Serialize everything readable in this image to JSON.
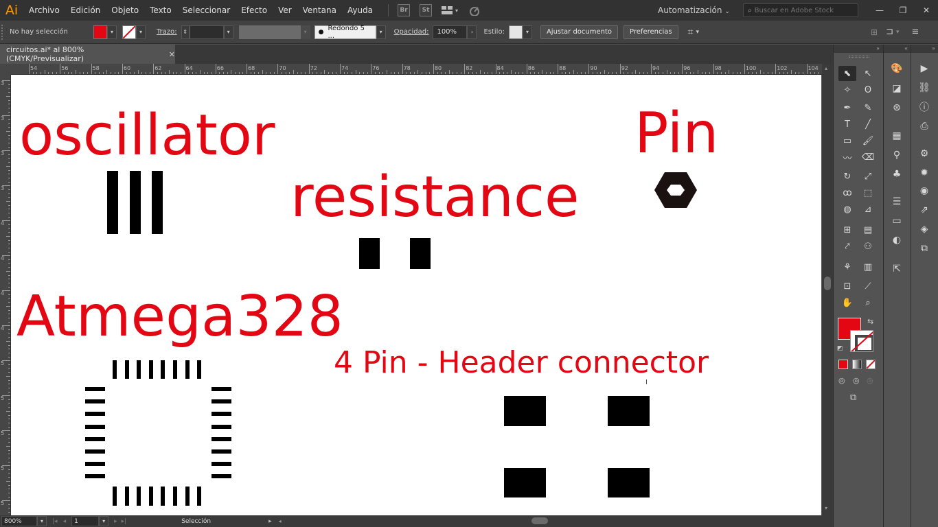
{
  "app": {
    "logo": "Ai",
    "menu": [
      "Archivo",
      "Edición",
      "Objeto",
      "Texto",
      "Seleccionar",
      "Efecto",
      "Ver",
      "Ventana",
      "Ayuda"
    ],
    "bridge_label": "Br",
    "stock_label": "St",
    "workspace": "Automatización",
    "stock_search_placeholder": "Buscar en Adobe Stock",
    "window_controls": [
      "—",
      "❐",
      "✕"
    ]
  },
  "control_bar": {
    "selection_status": "No hay selección",
    "fill_color": "#e30613",
    "stroke_label": "Trazo:",
    "stroke_weight": "",
    "brush_profile": "Redondo 5 ...",
    "opacity_label": "Opacidad:",
    "opacity_value": "100%",
    "style_label": "Estilo:",
    "fit_document_button": "Ajustar documento",
    "preferences_button": "Preferencias"
  },
  "document": {
    "tab_title": "circuitos.ai* al 800% (CMYK/Previsualizar)",
    "close_glyph": "✕",
    "ruler_h": [
      "54",
      "56",
      "58",
      "60",
      "62",
      "64",
      "66",
      "68",
      "70",
      "72",
      "74",
      "76",
      "78",
      "80",
      "82",
      "84",
      "86",
      "88",
      "90",
      "92",
      "94",
      "96",
      "98",
      "100",
      "102",
      "104"
    ],
    "ruler_v": [
      "3",
      "3",
      "3",
      "3",
      "4",
      "4",
      "4",
      "4",
      "5",
      "5",
      "5",
      "5",
      "5"
    ],
    "zoom": "800%",
    "artboard_number": "1",
    "current_tool_status": "Selección"
  },
  "artwork": {
    "oscillator_label": "oscillator",
    "resistance_label": "resistance",
    "pin_label": "Pin",
    "atmega_label": "Atmega328",
    "header_label": "4 Pin - Header connector",
    "text_color": "#e30613",
    "pad_color": "#000000"
  },
  "tools": {
    "fill_color": "#e30613",
    "stroke_color": "#ffffff"
  }
}
